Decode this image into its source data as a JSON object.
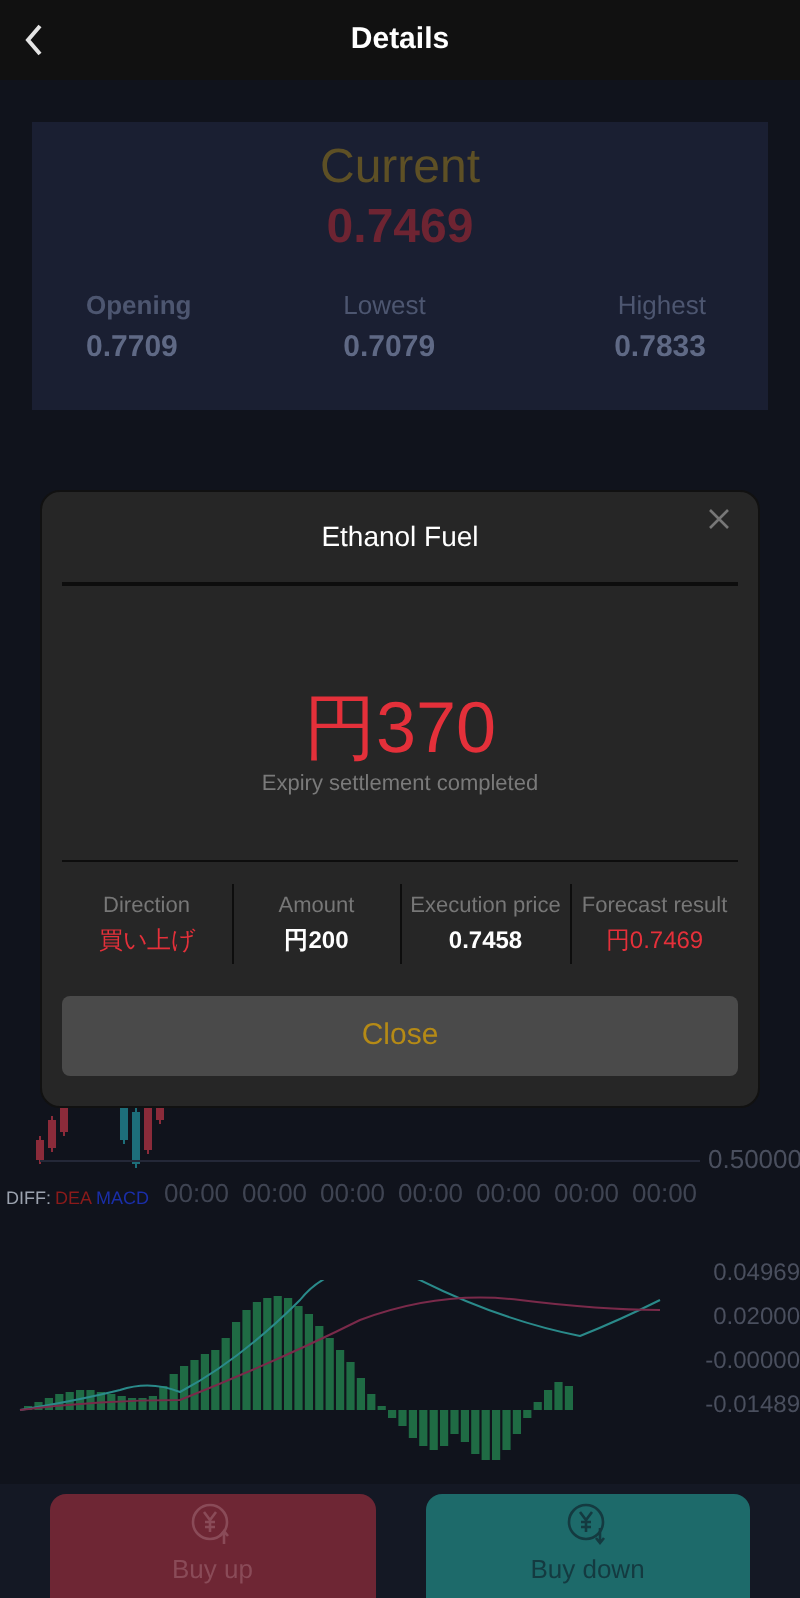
{
  "header": {
    "title": "Details"
  },
  "summary": {
    "current_label": "Current",
    "current_value": "0.7469",
    "stats": [
      {
        "label": "Opening",
        "value": "0.7709",
        "bold": true
      },
      {
        "label": "Lowest",
        "value": "0.7079",
        "bold": false
      },
      {
        "label": "Highest",
        "value": "0.7833",
        "bold": false
      }
    ]
  },
  "chart": {
    "price_label": "0.50000",
    "time_labels": [
      "00:00",
      "00:00",
      "00:00",
      "00:00",
      "00:00",
      "00:00",
      "00:00"
    ],
    "legend": [
      {
        "label": "DIFF:",
        "color": "#9ca3af"
      },
      {
        "label": "DEA",
        "color": "#8b1a1a"
      },
      {
        "label": "MACD",
        "color": "#1a2ea8"
      }
    ],
    "macd_labels": [
      "0.04969",
      "0.02000",
      "-0.00000",
      "-0.01489"
    ]
  },
  "dialog": {
    "title": "Ethanol Fuel",
    "amount": "円370",
    "status": "Expiry settlement completed",
    "details": [
      {
        "label": "Direction",
        "value": "買い上げ",
        "highlight": true
      },
      {
        "label": "Amount",
        "value": "円200",
        "highlight": false
      },
      {
        "label": "Execution price",
        "value": "0.7458",
        "highlight": false
      },
      {
        "label": "Forecast result",
        "value": "円0.7469",
        "highlight": true
      }
    ],
    "close": "Close"
  },
  "actions": [
    {
      "label": "Buy up",
      "kind": "up"
    },
    {
      "label": "Buy down",
      "kind": "down"
    }
  ]
}
